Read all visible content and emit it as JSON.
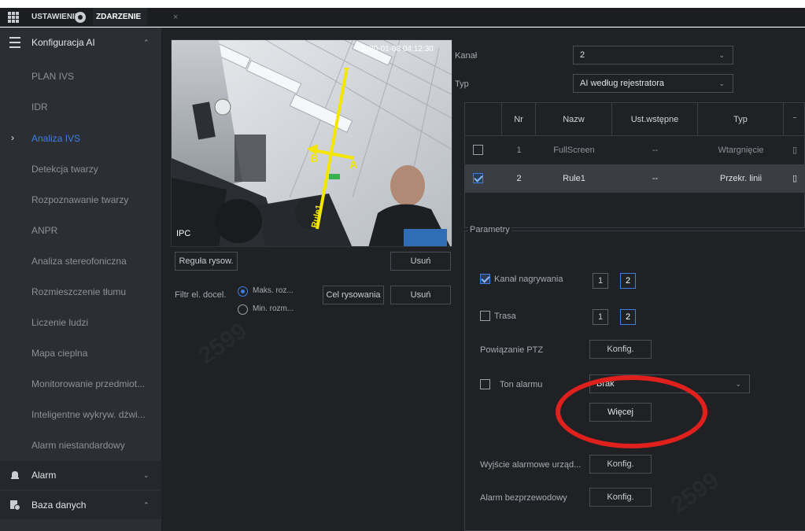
{
  "tabs": {
    "setting": "USTAWIENIE",
    "event": "ZDARZENIE",
    "close": "×"
  },
  "sidebar": {
    "ai_config": "Konfiguracja AI",
    "items": [
      "PLAN IVS",
      "IDR",
      "Analiza IVS",
      "Detekcja twarzy",
      "Rozpoznawanie twarzy",
      "ANPR",
      "Analiza stereofoniczna",
      "Rozmieszczenie tłumu",
      "Liczenie ludzi",
      "Mapa cieplna",
      "Monitorowanie przedmiot...",
      "Inteligentne wykryw. dźwi...",
      "Alarm niestandardowy"
    ],
    "active_index": 2,
    "alarm": "Alarm",
    "database": "Baza danych"
  },
  "video": {
    "timestamp": "2020-01-08 04:12:30",
    "channel_label": "IPC",
    "marker_b": "B",
    "marker_a": "A",
    "rule_text": "Rule1"
  },
  "controls": {
    "draw_rule": "Reguła rysow.",
    "delete1": "Usuń",
    "filter_label": "Filtr el. docel.",
    "max_size": "Maks. roz...",
    "min_size": "Min. rozm...",
    "draw_target": "Cel rysowania",
    "delete2": "Usuń"
  },
  "right": {
    "channel_label": "Kanał",
    "channel_value": "2",
    "type_label": "Typ",
    "type_value": "AI według rejestratora"
  },
  "table": {
    "headers": [
      "Nr",
      "Nazw",
      "Ust.wstępne",
      "Typ"
    ],
    "rows": [
      {
        "nr": "1",
        "name": "FullScreen",
        "preset": "--",
        "type": "Wtargnięcie",
        "checked": false
      },
      {
        "nr": "2",
        "name": "Rule1",
        "preset": "--",
        "type": "Przekr. linii",
        "checked": true
      }
    ]
  },
  "params": {
    "legend": "Parametry",
    "record_channel": "Kanał nagrywania",
    "rec_n1": "1",
    "rec_n2": "2",
    "route": "Trasa",
    "route_n1": "1",
    "route_n2": "2",
    "ptz_link": "Powiązanie PTZ",
    "config": "Konfig.",
    "alarm_tone": "Ton alarmu",
    "alarm_tone_value": "Brak",
    "more": "Więcej",
    "alarm_out": "Wyjście alarmowe urząd...",
    "config2": "Konfig.",
    "wireless_alarm": "Alarm bezprzewodowy",
    "config3": "Konfig."
  },
  "colors": {
    "accent": "#3d7ee9",
    "highlight": "#e0201c",
    "tripwire": "#f3e600"
  }
}
